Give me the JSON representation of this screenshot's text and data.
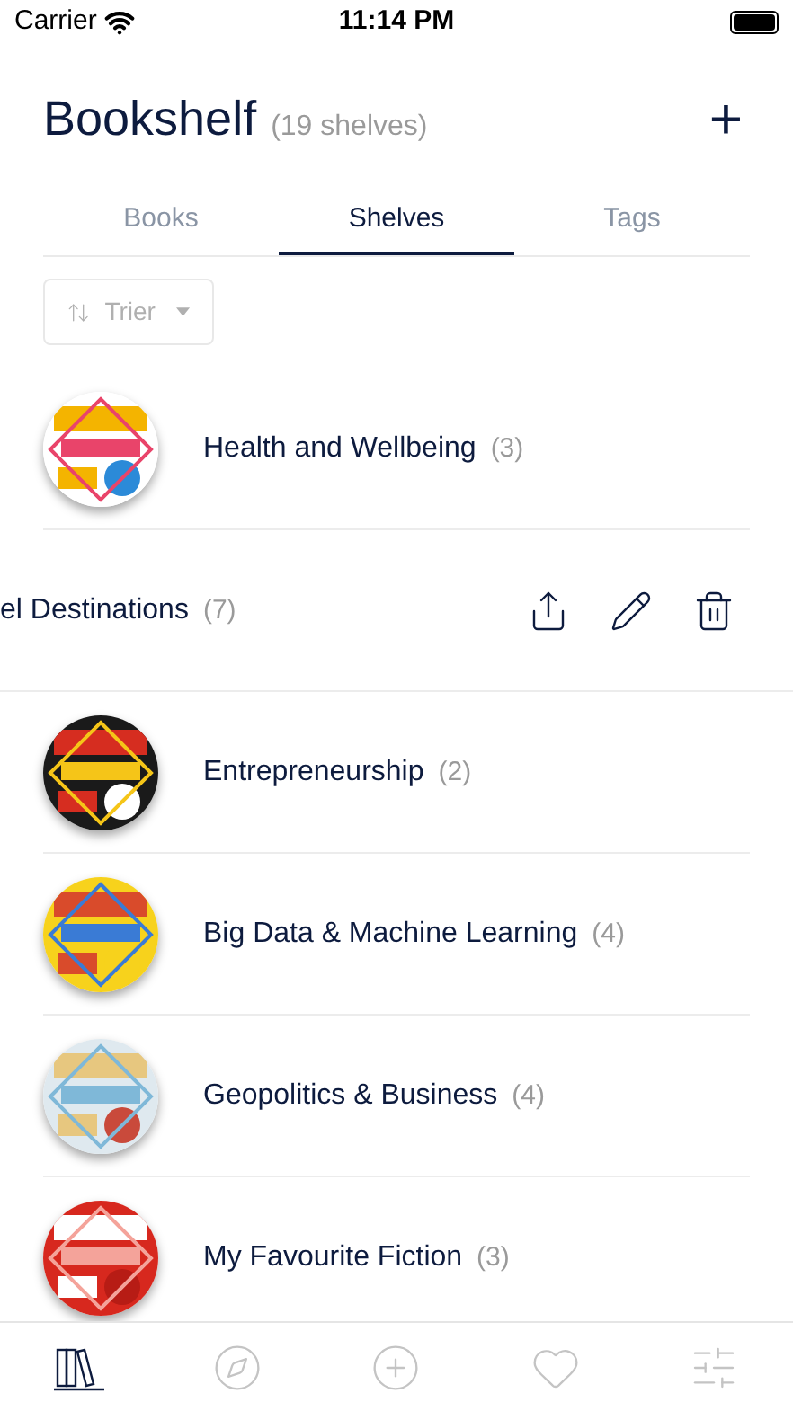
{
  "status_bar": {
    "carrier": "Carrier",
    "time": "11:14 PM"
  },
  "header": {
    "title": "Bookshelf",
    "count": "(19 shelves)",
    "add_label": "+"
  },
  "tabs": [
    {
      "label": "Books",
      "selected": false
    },
    {
      "label": "Shelves",
      "selected": true
    },
    {
      "label": "Tags",
      "selected": false
    }
  ],
  "sort": {
    "label": "Trier"
  },
  "shelves": [
    {
      "kind": "normal",
      "name": "Health and Wellbeing",
      "count": "(3)"
    },
    {
      "kind": "swiped",
      "name": "el Destinations",
      "count": "(7)"
    },
    {
      "kind": "normal",
      "name": "Entrepreneurship",
      "count": "(2)"
    },
    {
      "kind": "normal",
      "name": "Big Data & Machine Learning",
      "count": "(4)"
    },
    {
      "kind": "normal",
      "name": "Geopolitics & Business",
      "count": "(4)"
    },
    {
      "kind": "normal",
      "name": "My Favourite Fiction",
      "count": "(3)"
    }
  ],
  "tab_bar": [
    {
      "kind": "books",
      "selected": true
    },
    {
      "kind": "compass",
      "selected": false
    },
    {
      "kind": "add",
      "selected": false
    },
    {
      "kind": "heart",
      "selected": false
    },
    {
      "kind": "sliders",
      "selected": false
    }
  ]
}
